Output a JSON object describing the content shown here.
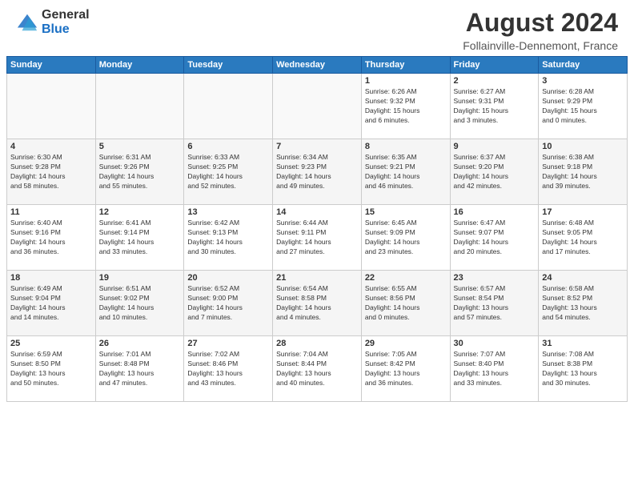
{
  "header": {
    "logo_general": "General",
    "logo_blue": "Blue",
    "month_year": "August 2024",
    "location": "Follainville-Dennemont, France"
  },
  "days_of_week": [
    "Sunday",
    "Monday",
    "Tuesday",
    "Wednesday",
    "Thursday",
    "Friday",
    "Saturday"
  ],
  "weeks": [
    {
      "days": [
        {
          "num": "",
          "info": ""
        },
        {
          "num": "",
          "info": ""
        },
        {
          "num": "",
          "info": ""
        },
        {
          "num": "",
          "info": ""
        },
        {
          "num": "1",
          "info": "Sunrise: 6:26 AM\nSunset: 9:32 PM\nDaylight: 15 hours\nand 6 minutes."
        },
        {
          "num": "2",
          "info": "Sunrise: 6:27 AM\nSunset: 9:31 PM\nDaylight: 15 hours\nand 3 minutes."
        },
        {
          "num": "3",
          "info": "Sunrise: 6:28 AM\nSunset: 9:29 PM\nDaylight: 15 hours\nand 0 minutes."
        }
      ]
    },
    {
      "days": [
        {
          "num": "4",
          "info": "Sunrise: 6:30 AM\nSunset: 9:28 PM\nDaylight: 14 hours\nand 58 minutes."
        },
        {
          "num": "5",
          "info": "Sunrise: 6:31 AM\nSunset: 9:26 PM\nDaylight: 14 hours\nand 55 minutes."
        },
        {
          "num": "6",
          "info": "Sunrise: 6:33 AM\nSunset: 9:25 PM\nDaylight: 14 hours\nand 52 minutes."
        },
        {
          "num": "7",
          "info": "Sunrise: 6:34 AM\nSunset: 9:23 PM\nDaylight: 14 hours\nand 49 minutes."
        },
        {
          "num": "8",
          "info": "Sunrise: 6:35 AM\nSunset: 9:21 PM\nDaylight: 14 hours\nand 46 minutes."
        },
        {
          "num": "9",
          "info": "Sunrise: 6:37 AM\nSunset: 9:20 PM\nDaylight: 14 hours\nand 42 minutes."
        },
        {
          "num": "10",
          "info": "Sunrise: 6:38 AM\nSunset: 9:18 PM\nDaylight: 14 hours\nand 39 minutes."
        }
      ]
    },
    {
      "days": [
        {
          "num": "11",
          "info": "Sunrise: 6:40 AM\nSunset: 9:16 PM\nDaylight: 14 hours\nand 36 minutes."
        },
        {
          "num": "12",
          "info": "Sunrise: 6:41 AM\nSunset: 9:14 PM\nDaylight: 14 hours\nand 33 minutes."
        },
        {
          "num": "13",
          "info": "Sunrise: 6:42 AM\nSunset: 9:13 PM\nDaylight: 14 hours\nand 30 minutes."
        },
        {
          "num": "14",
          "info": "Sunrise: 6:44 AM\nSunset: 9:11 PM\nDaylight: 14 hours\nand 27 minutes."
        },
        {
          "num": "15",
          "info": "Sunrise: 6:45 AM\nSunset: 9:09 PM\nDaylight: 14 hours\nand 23 minutes."
        },
        {
          "num": "16",
          "info": "Sunrise: 6:47 AM\nSunset: 9:07 PM\nDaylight: 14 hours\nand 20 minutes."
        },
        {
          "num": "17",
          "info": "Sunrise: 6:48 AM\nSunset: 9:05 PM\nDaylight: 14 hours\nand 17 minutes."
        }
      ]
    },
    {
      "days": [
        {
          "num": "18",
          "info": "Sunrise: 6:49 AM\nSunset: 9:04 PM\nDaylight: 14 hours\nand 14 minutes."
        },
        {
          "num": "19",
          "info": "Sunrise: 6:51 AM\nSunset: 9:02 PM\nDaylight: 14 hours\nand 10 minutes."
        },
        {
          "num": "20",
          "info": "Sunrise: 6:52 AM\nSunset: 9:00 PM\nDaylight: 14 hours\nand 7 minutes."
        },
        {
          "num": "21",
          "info": "Sunrise: 6:54 AM\nSunset: 8:58 PM\nDaylight: 14 hours\nand 4 minutes."
        },
        {
          "num": "22",
          "info": "Sunrise: 6:55 AM\nSunset: 8:56 PM\nDaylight: 14 hours\nand 0 minutes."
        },
        {
          "num": "23",
          "info": "Sunrise: 6:57 AM\nSunset: 8:54 PM\nDaylight: 13 hours\nand 57 minutes."
        },
        {
          "num": "24",
          "info": "Sunrise: 6:58 AM\nSunset: 8:52 PM\nDaylight: 13 hours\nand 54 minutes."
        }
      ]
    },
    {
      "days": [
        {
          "num": "25",
          "info": "Sunrise: 6:59 AM\nSunset: 8:50 PM\nDaylight: 13 hours\nand 50 minutes."
        },
        {
          "num": "26",
          "info": "Sunrise: 7:01 AM\nSunset: 8:48 PM\nDaylight: 13 hours\nand 47 minutes."
        },
        {
          "num": "27",
          "info": "Sunrise: 7:02 AM\nSunset: 8:46 PM\nDaylight: 13 hours\nand 43 minutes."
        },
        {
          "num": "28",
          "info": "Sunrise: 7:04 AM\nSunset: 8:44 PM\nDaylight: 13 hours\nand 40 minutes."
        },
        {
          "num": "29",
          "info": "Sunrise: 7:05 AM\nSunset: 8:42 PM\nDaylight: 13 hours\nand 36 minutes."
        },
        {
          "num": "30",
          "info": "Sunrise: 7:07 AM\nSunset: 8:40 PM\nDaylight: 13 hours\nand 33 minutes."
        },
        {
          "num": "31",
          "info": "Sunrise: 7:08 AM\nSunset: 8:38 PM\nDaylight: 13 hours\nand 30 minutes."
        }
      ]
    }
  ]
}
